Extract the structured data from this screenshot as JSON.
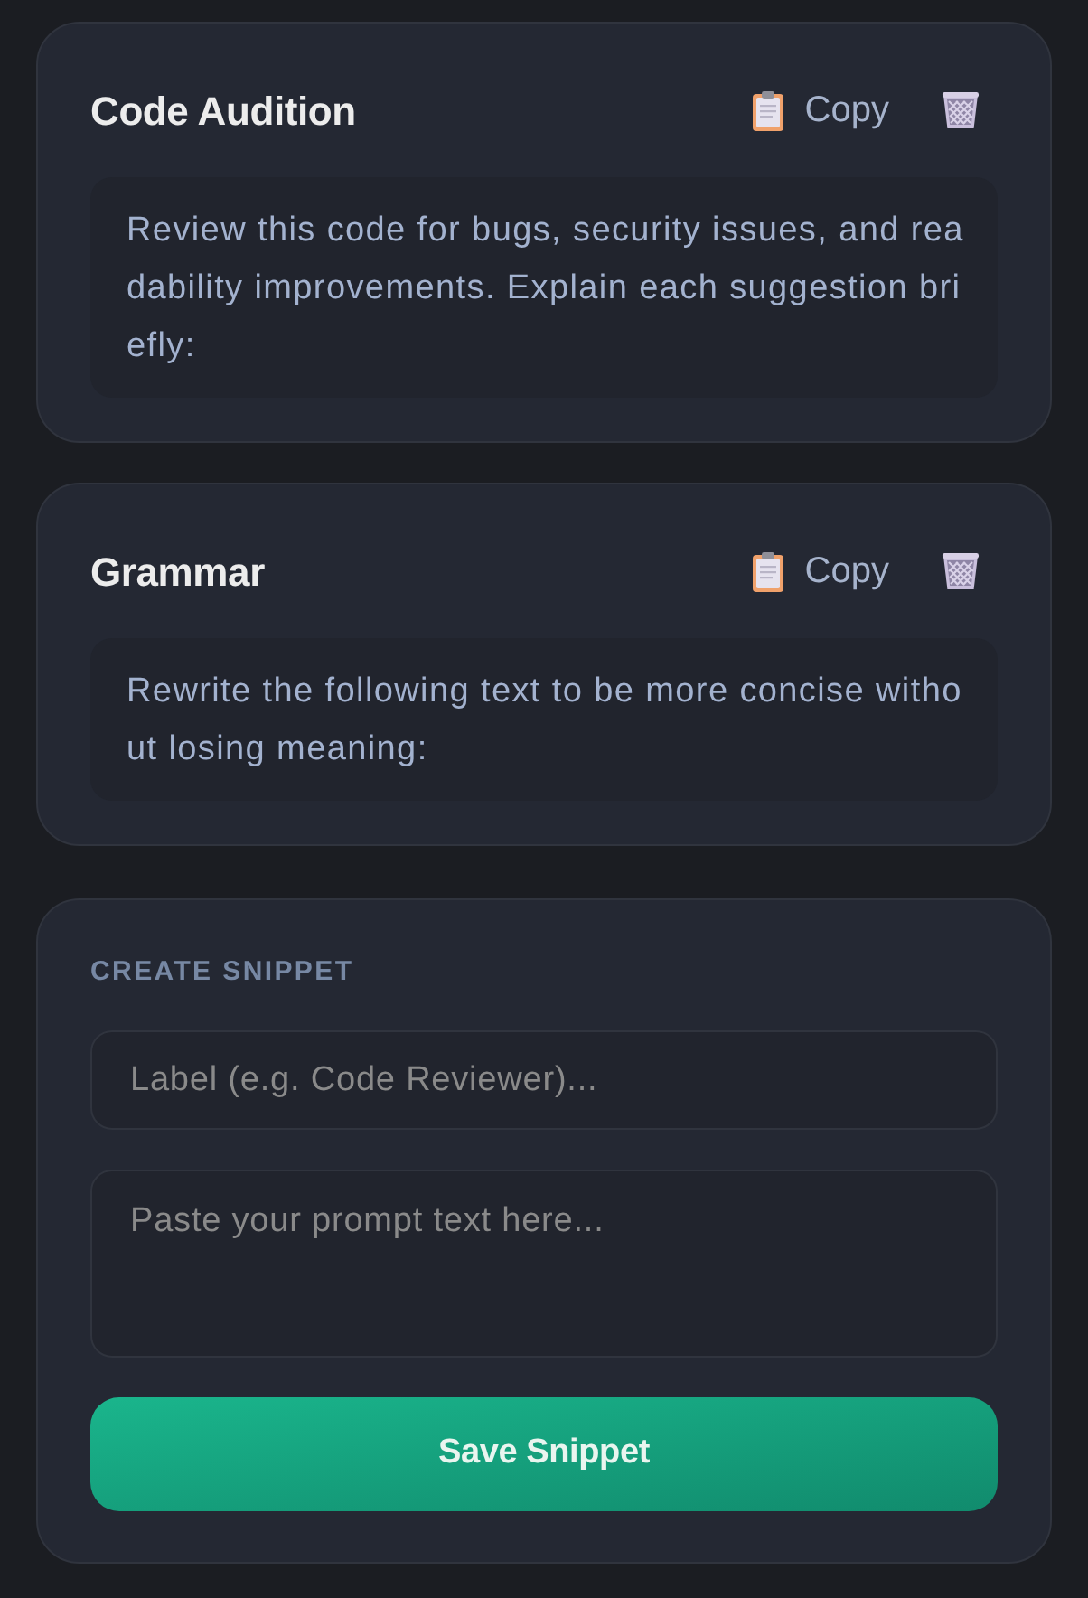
{
  "snippets": [
    {
      "title": "Code Audition",
      "copy_label": "Copy",
      "text": "Review this code for bugs, security issues, and readability improvements. Explain each suggestion briefly:"
    },
    {
      "title": "Grammar",
      "copy_label": "Copy",
      "text": "Rewrite the following text to be more concise without losing meaning:"
    }
  ],
  "create_form": {
    "heading": "CREATE SNIPPET",
    "label_field": {
      "placeholder": "Label (e.g. Code Reviewer)..."
    },
    "prompt_field": {
      "placeholder": "Paste your prompt text here..."
    },
    "save_button": "Save Snippet"
  }
}
